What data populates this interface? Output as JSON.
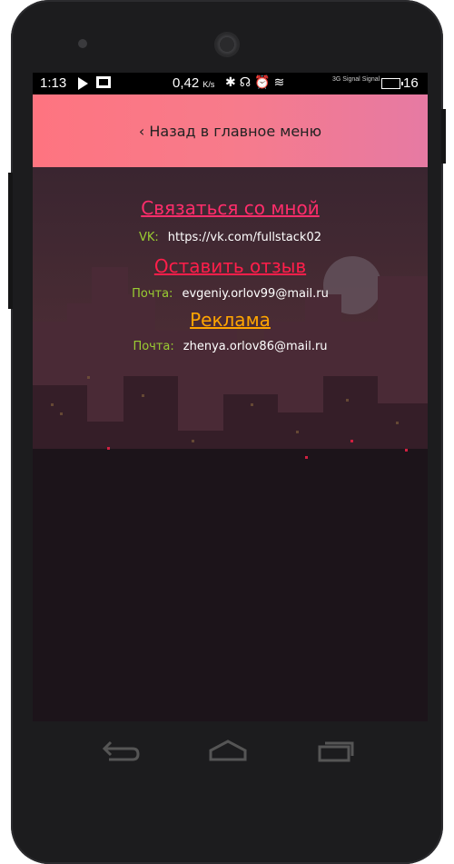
{
  "statusbar": {
    "time": "1:13",
    "speed_value": "0,42",
    "speed_unit": "K/s",
    "signal_label_1": "3G Signal",
    "signal_label_2": "Signal",
    "battery": "16"
  },
  "header": {
    "back_label": "‹ Назад в главное меню"
  },
  "sections": {
    "contact": {
      "title": "Связаться со мной",
      "label": "VK:",
      "value": "https://vk.com/fullstack02"
    },
    "review": {
      "title": "Оставить отзыв",
      "label": "Почта:",
      "value": "evgeniy.orlov99@mail.ru"
    },
    "ads": {
      "title": "Реклама",
      "label": "Почта:",
      "value": "zhenya.orlov86@mail.ru"
    }
  },
  "colors": {
    "header_start": "#fe7480",
    "header_end": "#e67aa3",
    "title_contact": "#ff2d6b",
    "title_review": "#ff1e4a",
    "title_ads": "#ffa500",
    "label": "#9acd32"
  }
}
